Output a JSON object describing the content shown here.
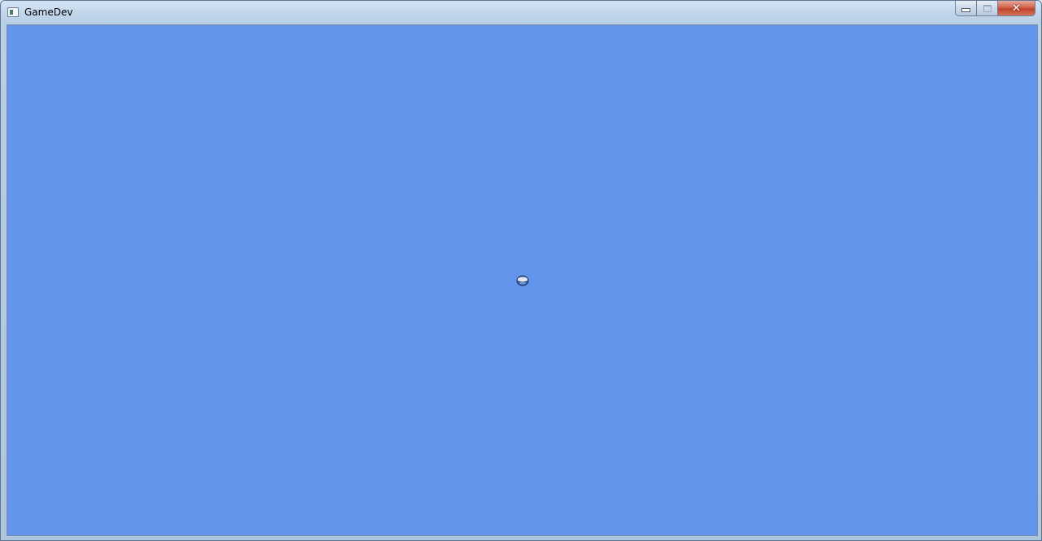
{
  "window": {
    "title": "GameDev",
    "icon": "app-window-icon",
    "caption_buttons": [
      {
        "name": "minimize",
        "icon": "minimize-icon"
      },
      {
        "name": "maximize",
        "icon": "maximize-icon"
      },
      {
        "name": "close",
        "icon": "close-icon",
        "glyph": "✕"
      }
    ]
  },
  "game": {
    "background_color": "#6495ED",
    "sprite": "ball-sprite"
  }
}
